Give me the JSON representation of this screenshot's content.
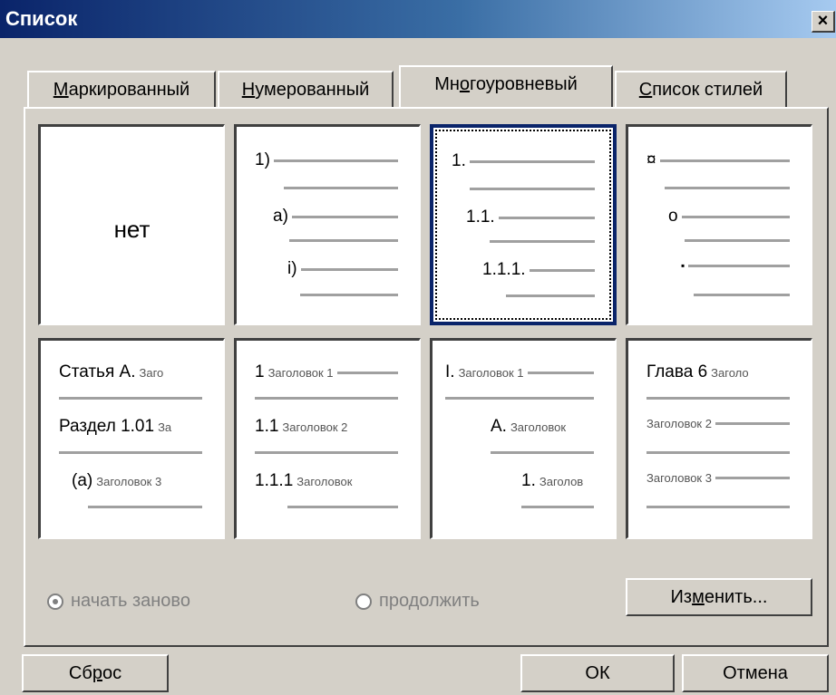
{
  "window": {
    "title": "Список",
    "close": "×"
  },
  "tabs": [
    {
      "label": "Маркированный",
      "accel": "М",
      "rest": "аркированный",
      "active": false
    },
    {
      "label": "Нумерованный",
      "accel": "Н",
      "rest": "умерованный",
      "active": false
    },
    {
      "label": "Многоуровневый",
      "pre": "Мн",
      "accel": "о",
      "rest": "гоуровневый",
      "active": true
    },
    {
      "label": "Список стилей",
      "accel": "С",
      "rest": "писок стилей",
      "active": false
    }
  ],
  "gallery": {
    "none_label": "нет",
    "cell2": {
      "l1": "1)",
      "l2": "a)",
      "l3": "i)"
    },
    "cell3": {
      "l1": "1.",
      "l2": "1.1.",
      "l3": "1.1.1."
    },
    "cell4": {
      "l1": "¤",
      "l2": "o",
      "l3": "▪"
    },
    "cell5": {
      "l1a": "Статья А.",
      "l1b": "Заго",
      "l2a": "Раздел 1.01",
      "l2b": "За",
      "l3a": "(a)",
      "l3b": "Заголовок 3"
    },
    "cell6": {
      "l1a": "1",
      "l1b": "Заголовок 1",
      "l2a": "1.1",
      "l2b": "Заголовок 2",
      "l3a": "1.1.1",
      "l3b": "Заголовок"
    },
    "cell7": {
      "l1a": "I.",
      "l1b": "Заголовок 1",
      "l2a": "A.",
      "l2b": "Заголовок",
      "l3a": "1.",
      "l3b": "Заголов"
    },
    "cell8": {
      "l1a": "Глава 6",
      "l1b": "Заголо",
      "l2b": "Заголовок 2",
      "l3b": "Заголовок 3"
    }
  },
  "options": {
    "restart": "начать заново",
    "continue": "продолжить"
  },
  "buttons": {
    "modify_pre": "Из",
    "modify_accel": "м",
    "modify_rest": "енить...",
    "reset_pre": "Сб",
    "reset_accel": "р",
    "reset_rest": "ос",
    "ok": "ОК",
    "cancel": "Отмена"
  }
}
